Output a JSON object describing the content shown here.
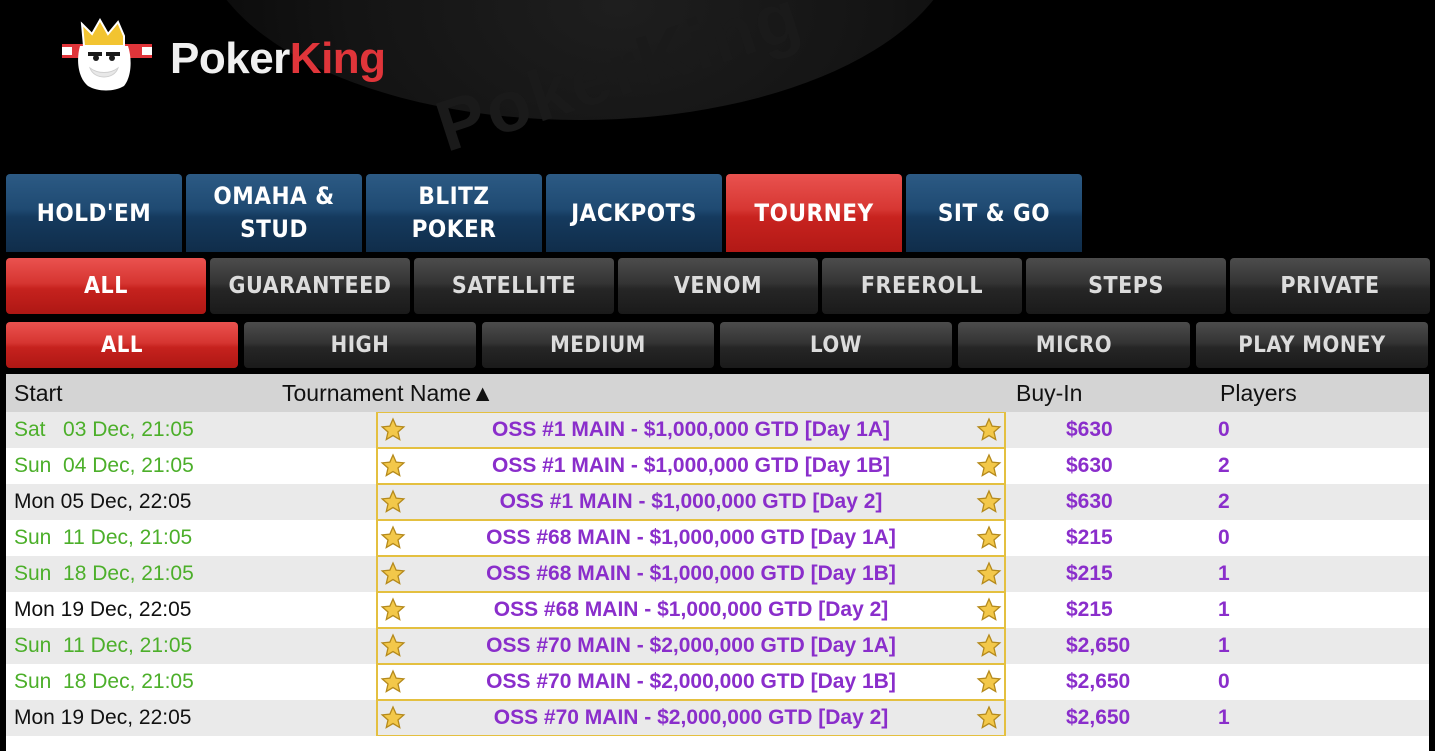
{
  "brand": {
    "poker": "Poker",
    "king": "King",
    "watermark": "PokerKing"
  },
  "main_tabs": [
    {
      "label": "HOLD'EM",
      "active": false
    },
    {
      "label": "OMAHA &\nSTUD",
      "active": false
    },
    {
      "label": "BLITZ\nPOKER",
      "active": false
    },
    {
      "label": "JACKPOTS",
      "active": false
    },
    {
      "label": "TOURNEY",
      "active": true
    },
    {
      "label": "SIT & GO",
      "active": false
    }
  ],
  "type_tabs": [
    {
      "label": "ALL",
      "active": true
    },
    {
      "label": "GUARANTEED",
      "active": false
    },
    {
      "label": "SATELLITE",
      "active": false
    },
    {
      "label": "VENOM",
      "active": false
    },
    {
      "label": "FREEROLL",
      "active": false
    },
    {
      "label": "STEPS",
      "active": false
    },
    {
      "label": "PRIVATE",
      "active": false
    }
  ],
  "level_tabs": [
    {
      "label": "ALL",
      "active": true
    },
    {
      "label": "HIGH",
      "active": false
    },
    {
      "label": "MEDIUM",
      "active": false
    },
    {
      "label": "LOW",
      "active": false
    },
    {
      "label": "MICRO",
      "active": false
    },
    {
      "label": "PLAY MONEY",
      "active": false
    }
  ],
  "table": {
    "headers": {
      "start": "Start",
      "name": "Tournament Name▲",
      "buyin": "Buy-In",
      "players": "Players"
    },
    "rows": [
      {
        "start": "Sat   03 Dec, 21:05",
        "status": "green",
        "name": "OSS #1 MAIN - $1,000,000 GTD [Day 1A]",
        "buyin": "$630",
        "players": "0"
      },
      {
        "start": "Sun  04 Dec, 21:05",
        "status": "green",
        "name": "OSS #1 MAIN - $1,000,000 GTD [Day 1B]",
        "buyin": "$630",
        "players": "2"
      },
      {
        "start": "Mon 05 Dec, 22:05",
        "status": "black",
        "name": "OSS #1 MAIN - $1,000,000 GTD [Day 2]",
        "buyin": "$630",
        "players": "2"
      },
      {
        "start": "Sun  11 Dec, 21:05",
        "status": "green",
        "name": "OSS #68 MAIN - $1,000,000 GTD [Day 1A]",
        "buyin": "$215",
        "players": "0"
      },
      {
        "start": "Sun  18 Dec, 21:05",
        "status": "green",
        "name": "OSS #68 MAIN - $1,000,000 GTD [Day 1B]",
        "buyin": "$215",
        "players": "1"
      },
      {
        "start": "Mon 19 Dec, 22:05",
        "status": "black",
        "name": "OSS #68 MAIN - $1,000,000 GTD [Day 2]",
        "buyin": "$215",
        "players": "1"
      },
      {
        "start": "Sun  11 Dec, 21:05",
        "status": "green",
        "name": "OSS #70 MAIN - $2,000,000 GTD [Day 1A]",
        "buyin": "$2,650",
        "players": "1"
      },
      {
        "start": "Sun  18 Dec, 21:05",
        "status": "green",
        "name": "OSS #70 MAIN - $2,000,000 GTD [Day 1B]",
        "buyin": "$2,650",
        "players": "0"
      },
      {
        "start": "Mon 19 Dec, 22:05",
        "status": "black",
        "name": "OSS #70 MAIN - $2,000,000 GTD [Day 2]",
        "buyin": "$2,650",
        "players": "1"
      }
    ]
  },
  "colors": {
    "accent_red": "#d73733",
    "tab_blue": "#1f4a72",
    "name_purple": "#8a2ecb",
    "start_green": "#4caf2a",
    "star_gold": "#e4c040"
  },
  "icons": {
    "favorite": "star-icon",
    "logo": "king-mascot-icon"
  }
}
